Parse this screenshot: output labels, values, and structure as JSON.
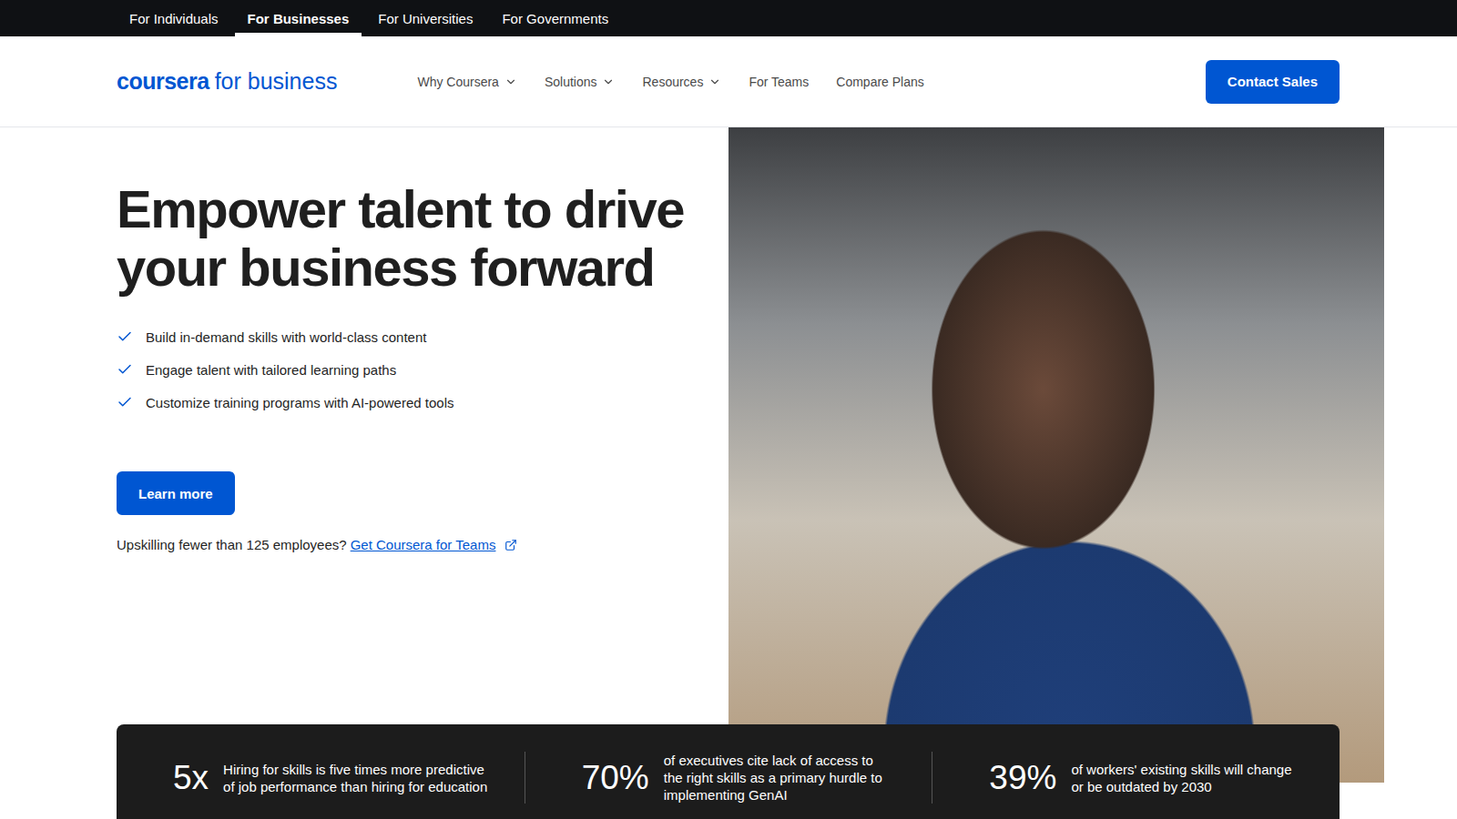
{
  "top_nav": [
    {
      "label": "For Individuals",
      "selected": false
    },
    {
      "label": "For Businesses",
      "selected": true
    },
    {
      "label": "For Universities",
      "selected": false
    },
    {
      "label": "For Governments",
      "selected": false
    }
  ],
  "logo": {
    "brand": "coursera",
    "suffix": "for business"
  },
  "nav": [
    {
      "label": "Why Coursera",
      "dropdown": true
    },
    {
      "label": "Solutions",
      "dropdown": true
    },
    {
      "label": "Resources",
      "dropdown": true
    },
    {
      "label": "For Teams",
      "dropdown": false
    },
    {
      "label": "Compare Plans",
      "dropdown": false
    }
  ],
  "contact_button": "Contact Sales",
  "hero": {
    "title": "Empower talent to drive your business forward",
    "bullets": [
      "Build in-demand skills with world-class content",
      "Engage talent with tailored learning paths",
      "Customize training programs with AI-powered tools"
    ],
    "button": "Learn more",
    "teams_prompt": "Upskilling fewer than 125 employees?",
    "teams_link": "Get Coursera for Teams"
  },
  "stats": [
    {
      "value": "5x",
      "text": "Hiring for skills is five times more predictive of job performance than hiring for education"
    },
    {
      "value": "70%",
      "text": "of executives cite lack of access to the right skills as a primary hurdle to implementing GenAI"
    },
    {
      "value": "39%",
      "text": "of workers' existing skills will change or be outdated by 2030"
    }
  ]
}
